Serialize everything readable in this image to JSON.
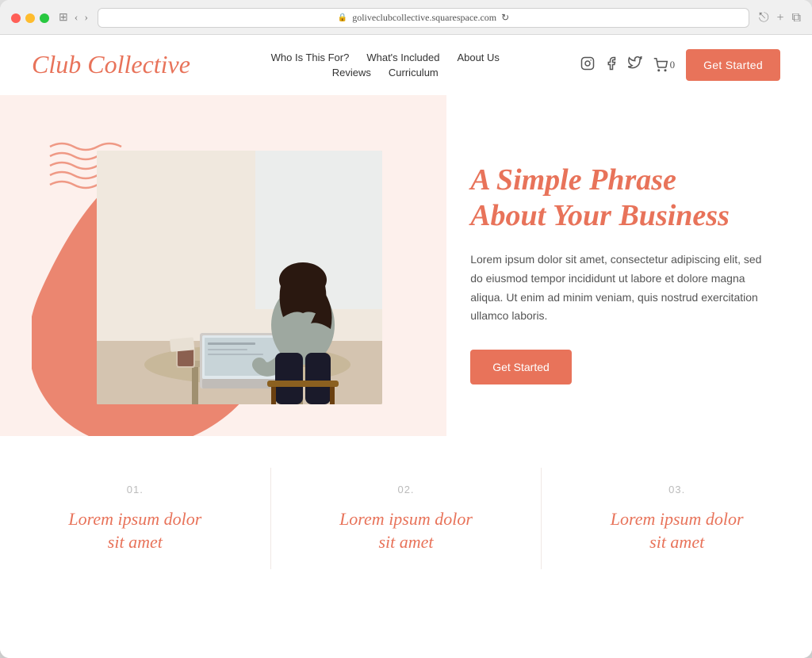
{
  "browser": {
    "url": "goliveclubcollective.squarespace.com"
  },
  "header": {
    "logo": "Club Collective",
    "nav": {
      "row1": [
        {
          "label": "Who Is This For?",
          "id": "who-is-this-for"
        },
        {
          "label": "What's Included",
          "id": "whats-included"
        },
        {
          "label": "About Us",
          "id": "about-us"
        }
      ],
      "row2": [
        {
          "label": "Reviews",
          "id": "reviews"
        },
        {
          "label": "Curriculum",
          "id": "curriculum"
        }
      ]
    },
    "cart_count": "0",
    "cta_label": "Get Started"
  },
  "hero": {
    "headline_line1": "A Simple Phrase",
    "headline_line2": "About Your Business",
    "body": "Lorem ipsum dolor sit amet, consectetur adipiscing elit, sed do eiusmod tempor incididunt ut labore et dolore magna aliqua. Ut enim ad minim veniam, quis nostrud exercitation ullamco laboris.",
    "cta_label": "Get Started"
  },
  "features": [
    {
      "number": "01.",
      "title_line1": "Lorem ipsum dolor",
      "title_line2": "sit amet"
    },
    {
      "number": "02.",
      "title_line1": "Lorem ipsum dolor",
      "title_line2": "sit amet"
    },
    {
      "number": "03.",
      "title_line1": "Lorem ipsum dolor",
      "title_line2": "sit amet"
    }
  ],
  "colors": {
    "coral": "#e8735a",
    "light_bg": "#fdf0ec",
    "text_dark": "#333333",
    "text_body": "#555555"
  }
}
